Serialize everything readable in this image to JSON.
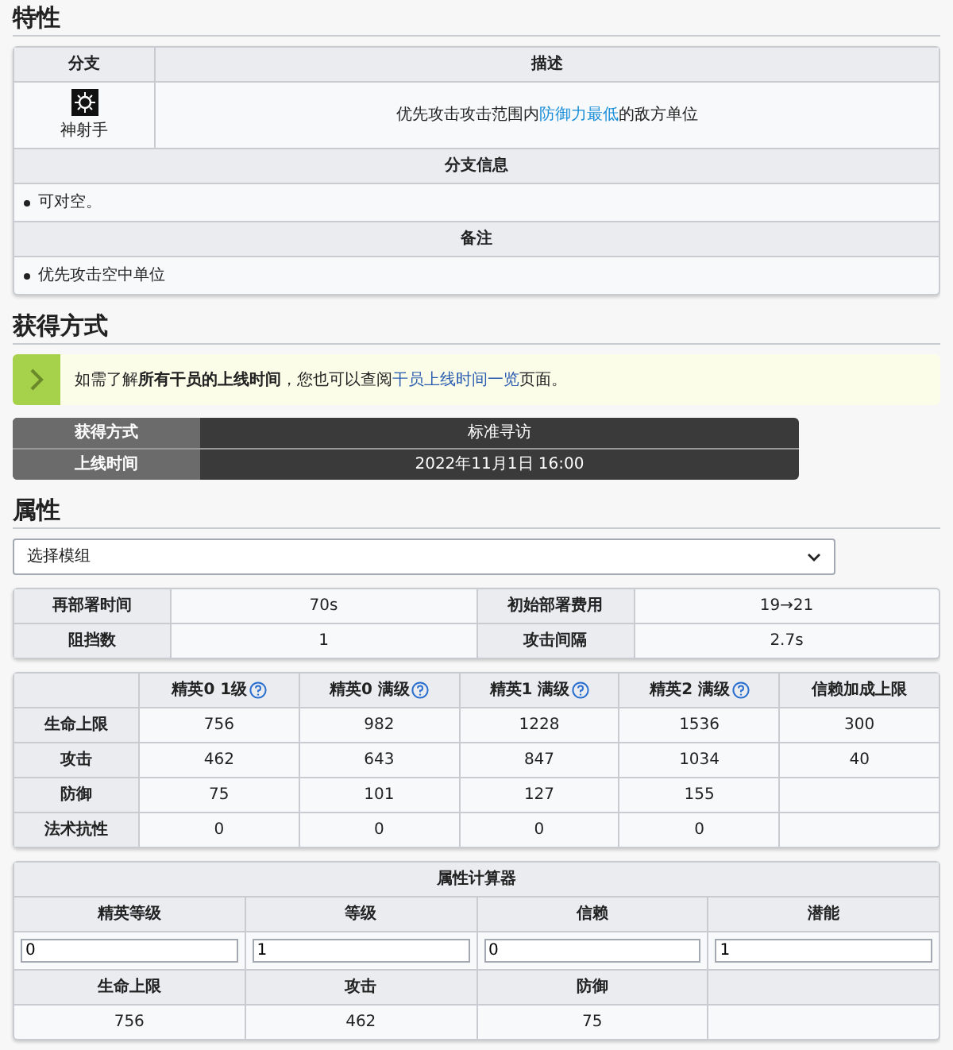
{
  "traits": {
    "heading": "特性",
    "columns": [
      "分支",
      "描述"
    ],
    "branch": "神射手",
    "description": [
      {
        "kind": "text",
        "text": "优先攻击攻击范围内"
      },
      {
        "kind": "link",
        "text": "防御力最低"
      },
      {
        "kind": "text",
        "text": "的敌方单位"
      }
    ],
    "info_heading": "分支信息",
    "info": [
      "可对空。"
    ],
    "notes_heading": "备注",
    "notes": [
      "优先攻击空中单位"
    ]
  },
  "obtain": {
    "heading": "获得方式",
    "notice": [
      {
        "kind": "text",
        "text": "如需了解"
      },
      {
        "kind": "bold",
        "text": "所有干员的上线时间"
      },
      {
        "kind": "text",
        "text": "，您也可以查阅"
      },
      {
        "kind": "link",
        "text": "干员上线时间一览"
      },
      {
        "kind": "text",
        "text": "页面。"
      }
    ],
    "rows": [
      {
        "label": "获得方式",
        "value": "标准寻访"
      },
      {
        "label": "上线时间",
        "value": "2022年11月1日 16:00"
      }
    ]
  },
  "attributes": {
    "heading": "属性",
    "module_select": {
      "value": "选择模组"
    },
    "basics": [
      [
        {
          "label": "再部署时间",
          "value": "70s"
        },
        {
          "label": "初始部署费用",
          "value": "19→21"
        }
      ],
      [
        {
          "label": "阻挡数",
          "value": "1"
        },
        {
          "label": "攻击间隔",
          "value": "2.7s"
        }
      ]
    ],
    "stats": {
      "columns": [
        {
          "label": "精英0 1级",
          "help": true
        },
        {
          "label": "精英0 满级",
          "help": true
        },
        {
          "label": "精英1 满级",
          "help": true
        },
        {
          "label": "精英2 满级",
          "help": true
        },
        {
          "label": "信赖加成上限",
          "help": false
        }
      ],
      "rows": [
        {
          "label": "生命上限",
          "values": [
            "756",
            "982",
            "1228",
            "1536",
            "300"
          ]
        },
        {
          "label": "攻击",
          "values": [
            "462",
            "643",
            "847",
            "1034",
            "40"
          ]
        },
        {
          "label": "防御",
          "values": [
            "75",
            "101",
            "127",
            "155"
          ]
        },
        {
          "label": "法术抗性",
          "values": [
            "0",
            "0",
            "0",
            "0"
          ]
        }
      ]
    },
    "calculator": {
      "title": "属性计算器",
      "fields": [
        {
          "label": "精英等级",
          "value": "0"
        },
        {
          "label": "等级",
          "value": "1"
        },
        {
          "label": "信赖",
          "value": "0"
        },
        {
          "label": "潜能",
          "value": "1"
        }
      ],
      "results": [
        {
          "label": "生命上限",
          "value": "756"
        },
        {
          "label": "攻击",
          "value": "462"
        },
        {
          "label": "防御",
          "value": "75"
        }
      ]
    }
  }
}
